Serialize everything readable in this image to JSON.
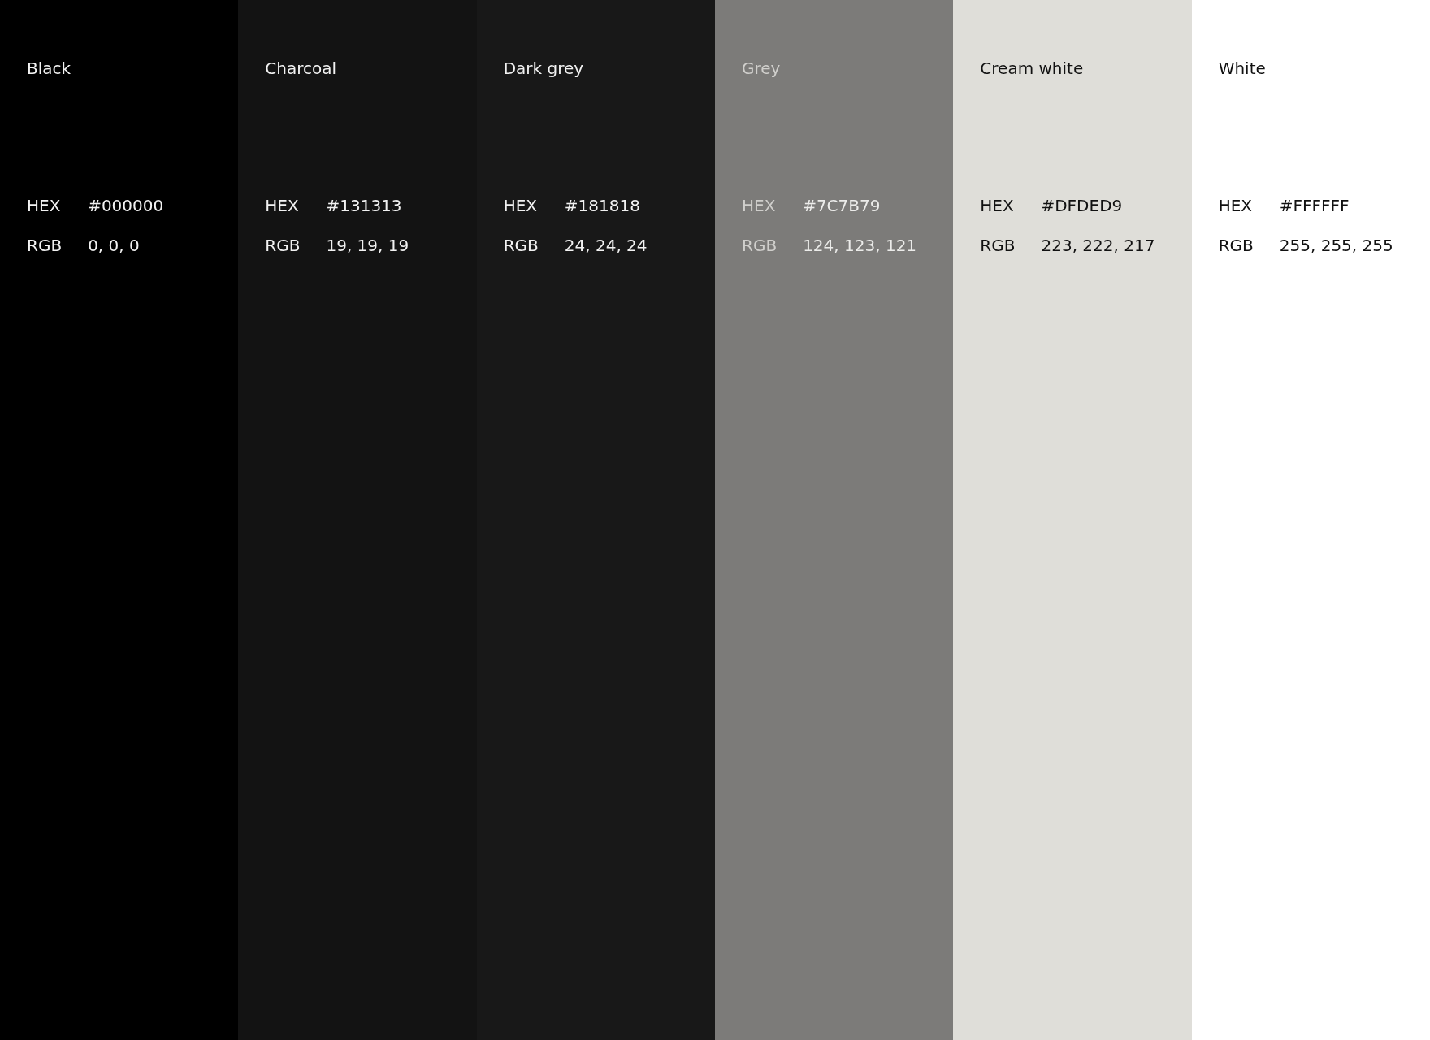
{
  "swatches": [
    {
      "name": "Black",
      "hex_label": "HEX",
      "hex": "#000000",
      "rgb_label": "RGB",
      "rgb": "0, 0, 0",
      "color": "#000000"
    },
    {
      "name": "Charcoal",
      "hex_label": "HEX",
      "hex": "#131313",
      "rgb_label": "RGB",
      "rgb": "19, 19, 19",
      "color": "#131313"
    },
    {
      "name": "Dark grey",
      "hex_label": "HEX",
      "hex": "#181818",
      "rgb_label": "RGB",
      "rgb": "24, 24, 24",
      "color": "#181818"
    },
    {
      "name": "Grey",
      "hex_label": "HEX",
      "hex": "#7C7B79",
      "rgb_label": "RGB",
      "rgb": "124, 123, 121",
      "color": "#7c7b79"
    },
    {
      "name": "Cream white",
      "hex_label": "HEX",
      "hex": "#DFDED9",
      "rgb_label": "RGB",
      "rgb": "223, 222, 217",
      "color": "#dfded9"
    },
    {
      "name": "White",
      "hex_label": "HEX",
      "hex": "#FFFFFF",
      "rgb_label": "RGB",
      "rgb": "255, 255, 255",
      "color": "#ffffff"
    }
  ]
}
